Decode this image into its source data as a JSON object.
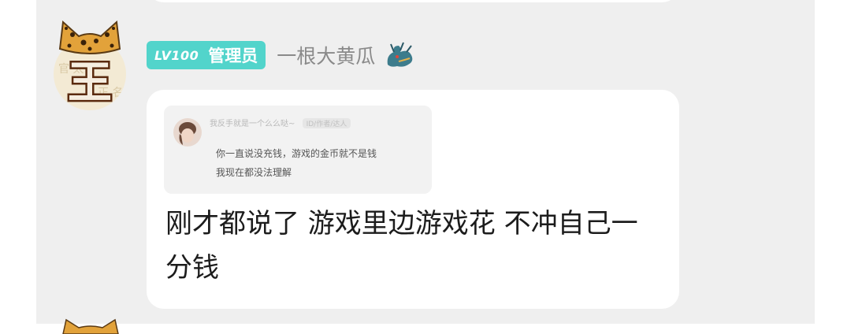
{
  "post": {
    "level_badge": "LV100",
    "role": "管理员",
    "username": "一根大黄瓜",
    "avatar_char": "王",
    "quote": {
      "nickname": "我反手就是一个么么哒~",
      "tag": "ID/作者/达人",
      "line1": "你一直说没充钱，游戏的金币就不是钱",
      "line2": "我现在都没法理解"
    },
    "message": "刚才都说了 游戏里边游戏花 不冲自己一分钱"
  },
  "icons": {
    "avatar": "tiger-hat-avatar",
    "decoration": "dragon-icon"
  },
  "colors": {
    "badge": "#52d4cb",
    "background": "#efefef",
    "bubble": "#ffffff"
  }
}
